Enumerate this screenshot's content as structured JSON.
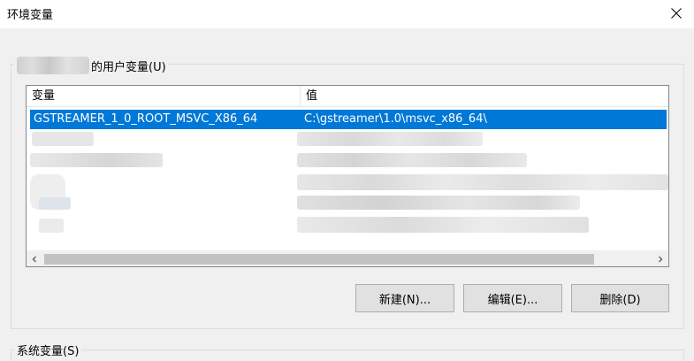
{
  "window": {
    "title": "环境变量",
    "close_icon": "close-icon"
  },
  "user_vars": {
    "group_label": "的用户变量(U)",
    "columns": [
      "变量",
      "值"
    ],
    "selected_row": {
      "name": "GSTREAMER_1_0_ROOT_MSVC_X86_64",
      "value": "C:\\gstreamer\\1.0\\msvc_x86_64\\"
    },
    "buttons": {
      "new": "新建(N)...",
      "edit": "编辑(E)...",
      "delete": "删除(D)"
    },
    "scroll_left_icon": "chevron-left-icon",
    "scroll_right_icon": "chevron-right-icon"
  },
  "system_vars": {
    "group_label": "系统变量(S)"
  },
  "colors": {
    "selection": "#0078d7",
    "window_bg": "#f0f0f0"
  }
}
